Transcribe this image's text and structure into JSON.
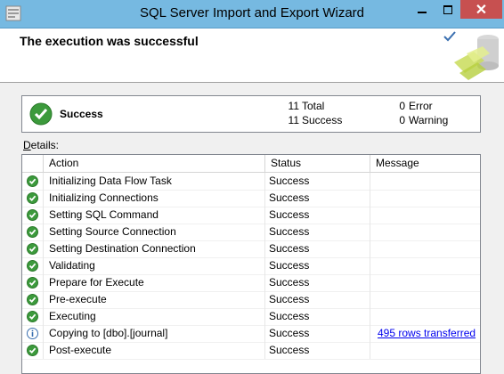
{
  "window": {
    "title": "SQL Server Import and Export Wizard",
    "close_glyph": "✕"
  },
  "header": {
    "title": "The execution was successful"
  },
  "summary": {
    "status_label": "Success",
    "total_count": "11",
    "total_label": "Total",
    "success_count": "11",
    "success_label": "Success",
    "error_count": "0",
    "error_label": "Error",
    "warning_count": "0",
    "warning_label": "Warning"
  },
  "details": {
    "label": "Details:",
    "columns": {
      "action": "Action",
      "status": "Status",
      "message": "Message"
    },
    "rows": [
      {
        "icon": "success-check-icon",
        "action": "Initializing Data Flow Task",
        "status": "Success",
        "message": ""
      },
      {
        "icon": "success-check-icon",
        "action": "Initializing Connections",
        "status": "Success",
        "message": ""
      },
      {
        "icon": "success-check-icon",
        "action": "Setting SQL Command",
        "status": "Success",
        "message": ""
      },
      {
        "icon": "success-check-icon",
        "action": "Setting Source Connection",
        "status": "Success",
        "message": ""
      },
      {
        "icon": "success-check-icon",
        "action": "Setting Destination Connection",
        "status": "Success",
        "message": ""
      },
      {
        "icon": "success-check-icon",
        "action": "Validating",
        "status": "Success",
        "message": ""
      },
      {
        "icon": "success-check-icon",
        "action": "Prepare for Execute",
        "status": "Success",
        "message": ""
      },
      {
        "icon": "success-check-icon",
        "action": "Pre-execute",
        "status": "Success",
        "message": ""
      },
      {
        "icon": "success-check-icon",
        "action": "Executing",
        "status": "Success",
        "message": ""
      },
      {
        "icon": "info-icon",
        "action": "Copying to [dbo].[journal]",
        "status": "Success",
        "message": "495 rows transferred"
      },
      {
        "icon": "success-check-icon",
        "action": "Post-execute",
        "status": "Success",
        "message": ""
      }
    ]
  },
  "colors": {
    "titlebar": "#76b9e1",
    "close_button": "#c75050",
    "success_green": "#3c9a3c",
    "link_blue": "#0000ee"
  }
}
